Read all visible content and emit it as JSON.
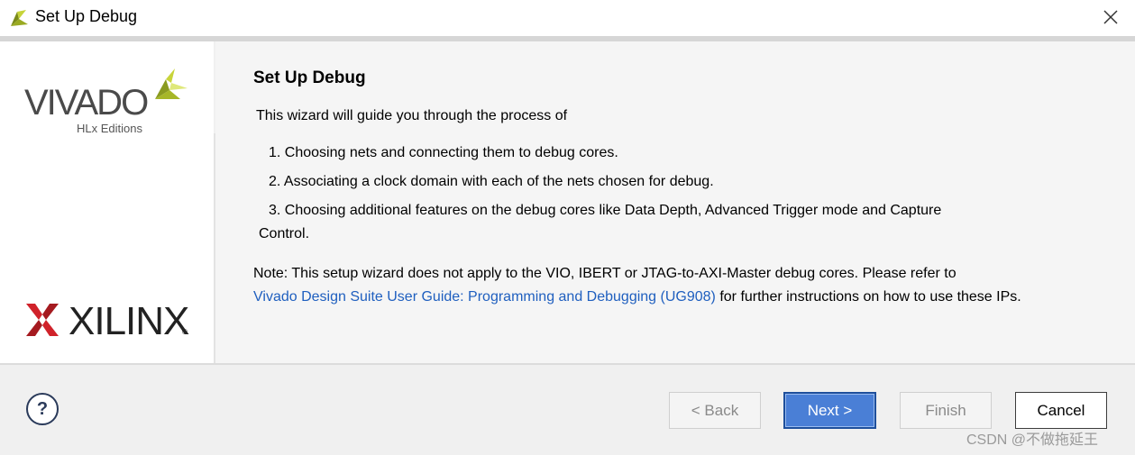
{
  "window": {
    "title": "Set Up Debug",
    "icon": "vivado-leaf-icon",
    "close_icon": "close-icon"
  },
  "branding": {
    "product_name": "VIVADO",
    "product_edition": "HLx Editions",
    "company": "XILINX",
    "registered_mark": "®",
    "accent_color": "#b8c832",
    "xilinx_color": "#d0222a"
  },
  "content": {
    "heading": "Set Up Debug",
    "intro": "This wizard will guide you through the process of",
    "steps": [
      "1.  Choosing nets and connecting them to debug cores.",
      "2.  Associating a clock domain with each of the nets chosen for debug.",
      "3.  Choosing additional features on the debug cores like Data Depth, Advanced Trigger mode and Capture"
    ],
    "step3_continuation": "Control.",
    "note_prefix": "Note: This setup wizard does not apply to the VIO, IBERT or JTAG-to-AXI-Master debug cores. Please refer to",
    "note_link": "Vivado Design Suite User Guide: Programming and Debugging (UG908)",
    "note_suffix": " for further instructions on how to use these IPs."
  },
  "footer": {
    "help_label": "?",
    "back_label": "< Back",
    "next_label": "Next >",
    "finish_label": "Finish",
    "cancel_label": "Cancel",
    "next_accent": "#4a7fd6"
  },
  "watermark": "CSDN @不做拖延王"
}
